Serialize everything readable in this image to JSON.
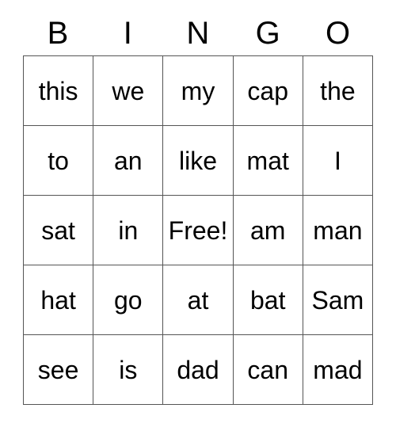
{
  "card": {
    "headers": [
      "B",
      "I",
      "N",
      "G",
      "O"
    ],
    "rows": [
      {
        "cells": [
          "this",
          "we",
          "my",
          "cap",
          "the"
        ]
      },
      {
        "cells": [
          "to",
          "an",
          "like",
          "mat",
          "I"
        ]
      },
      {
        "cells": [
          "sat",
          "in",
          "Free!",
          "am",
          "man"
        ]
      },
      {
        "cells": [
          "hat",
          "go",
          "at",
          "bat",
          "Sam"
        ]
      },
      {
        "cells": [
          "see",
          "is",
          "dad",
          "can",
          "mad"
        ]
      }
    ],
    "colors": {
      "background": "#ffffff",
      "border": "#555555",
      "text": "#000000"
    }
  }
}
